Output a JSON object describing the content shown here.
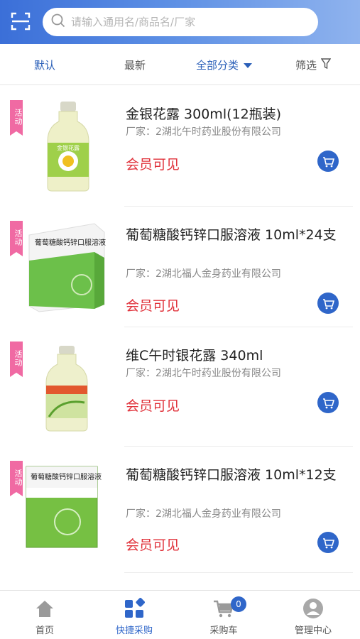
{
  "search": {
    "placeholder": "请输入通用名/商品名/厂家"
  },
  "filters": [
    {
      "label": "默认"
    },
    {
      "label": "最新"
    },
    {
      "label": "全部分类"
    },
    {
      "label": "筛选"
    }
  ],
  "products": [
    {
      "tag": "活动",
      "name": "金银花露 300ml(12瓶装)",
      "maker": "厂家：2湖北午时药业股份有限公司",
      "price": "会员可见",
      "box_title": "金银花露"
    },
    {
      "tag": "活动",
      "name": "葡萄糖酸钙锌口服溶液 10ml*24支",
      "maker": "厂家：2湖北福人金身药业有限公司",
      "price": "会员可见",
      "box_title": "葡萄糖酸钙锌口服溶液"
    },
    {
      "tag": "活动",
      "name": "维C午时银花露 340ml",
      "maker": "厂家：2湖北午时药业股份有限公司",
      "price": "会员可见",
      "box_title": ""
    },
    {
      "tag": "活动",
      "name": "葡萄糖酸钙锌口服溶液 10ml*12支",
      "maker": "厂家：2湖北福人金身药业有限公司",
      "price": "会员可见",
      "box_title": "葡萄糖酸钙锌口服溶液"
    }
  ],
  "tabbar": {
    "home": "首页",
    "quick": "快捷采购",
    "cart": "采购车",
    "cart_count": "0",
    "manage": "管理中心"
  },
  "colors": {
    "accent": "#2f66c9",
    "price": "#e0313a",
    "tag": "#f06aa3"
  }
}
